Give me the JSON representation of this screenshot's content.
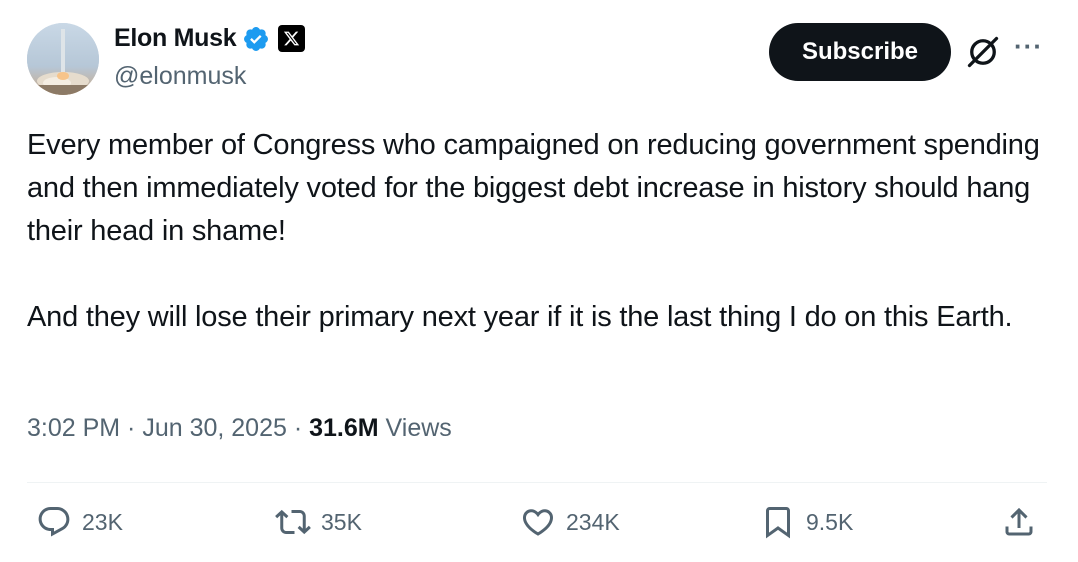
{
  "author": {
    "name": "Elon Musk",
    "handle": "@elonmusk",
    "verified_color": "#1d9bf0"
  },
  "header": {
    "subscribe_label": "Subscribe",
    "grok_icon": "grok-icon",
    "more_label": "···"
  },
  "tweet": {
    "paragraph1": "Every member of Congress who campaigned on reducing government spending and then immediately voted for the biggest debt increase in history should hang their head in shame!",
    "paragraph2": "And they will lose their primary next year if it is the last thing I do on this Earth."
  },
  "meta": {
    "time": "3:02 PM",
    "separator": " · ",
    "date": "Jun 30, 2025",
    "views_count": "31.6M",
    "views_label": " Views"
  },
  "actions": {
    "replies": "23K",
    "reposts": "35K",
    "likes": "234K",
    "bookmarks": "9.5K"
  }
}
